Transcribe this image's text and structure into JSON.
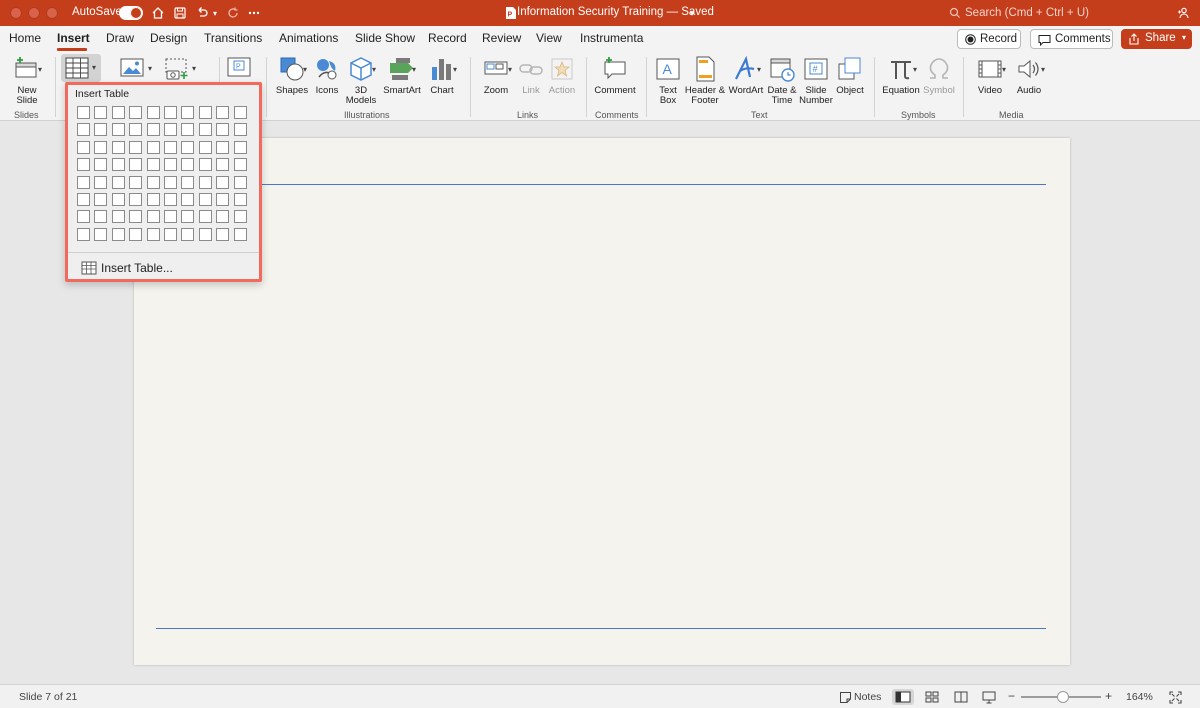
{
  "titlebar": {
    "autosave_label": "AutoSave",
    "document_title": "Information Security Training — Saved",
    "search_placeholder": "Search (Cmd + Ctrl + U)",
    "accent": "#c43e1c"
  },
  "tabs": [
    "Home",
    "Insert",
    "Draw",
    "Design",
    "Transitions",
    "Animations",
    "Slide Show",
    "Record",
    "Review",
    "View",
    "Instrumenta"
  ],
  "active_tab": "Insert",
  "header_buttons": {
    "record": "Record",
    "comments": "Comments",
    "share": "Share"
  },
  "ribbon": {
    "new_slide": [
      "New",
      "Slide"
    ],
    "shapes": "Shapes",
    "icons": "Icons",
    "models_3d": [
      "3D",
      "Models"
    ],
    "smartart": "SmartArt",
    "chart": "Chart",
    "zoom": "Zoom",
    "link": "Link",
    "action": "Action",
    "comment": "Comment",
    "text_box": [
      "Text",
      "Box"
    ],
    "header_footer": [
      "Header &",
      "Footer"
    ],
    "wordart": "WordArt",
    "date_time": [
      "Date &",
      "Time"
    ],
    "slide_number": [
      "Slide",
      "Number"
    ],
    "object": "Object",
    "equation": "Equation",
    "symbol": "Symbol",
    "video": "Video",
    "audio": "Audio",
    "groups": {
      "slides": "Slides",
      "illustrations": "Illustrations",
      "links": "Links",
      "comments": "Comments",
      "text": "Text",
      "symbols": "Symbols",
      "media": "Media"
    }
  },
  "insert_table_menu": {
    "title": "Insert Table",
    "grid_columns": 10,
    "grid_rows": 8,
    "insert_table_item": "Insert Table..."
  },
  "statusbar": {
    "slide_info": "Slide 7 of 21",
    "notes": "Notes",
    "zoom_minus": "−",
    "zoom_plus": "+",
    "zoom_level": "164%",
    "zoom_fraction": 0.52
  }
}
